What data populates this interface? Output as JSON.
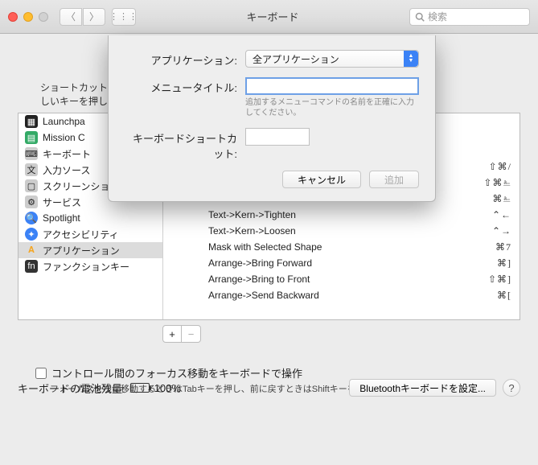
{
  "window": {
    "title": "キーボード",
    "search_placeholder": "検索"
  },
  "instruction": "ショートカットを変更するには、ショートカットを選択し、キーコンビネーションをクリックしてから、新しいキーを押します。",
  "instruction_line1": "ショートカット",
  "instruction_line2": "しいキーを押し",
  "sidebar": {
    "items": [
      {
        "label": "Launchpa",
        "icon": "launchpad-icon"
      },
      {
        "label": "Mission C",
        "icon": "mission-control-icon"
      },
      {
        "label": "キーボート",
        "icon": "keyboard-icon"
      },
      {
        "label": "入力ソース",
        "icon": "input-sources-icon"
      },
      {
        "label": "スクリーンショット",
        "icon": "screenshot-icon"
      },
      {
        "label": "サービス",
        "icon": "services-icon"
      },
      {
        "label": "Spotlight",
        "icon": "spotlight-icon"
      },
      {
        "label": "アクセシビリティ",
        "icon": "accessibility-icon"
      },
      {
        "label": "アプリケーション",
        "icon": "apps-icon",
        "selected": true
      },
      {
        "label": "ファンクションキー",
        "icon": "fn-icon"
      }
    ]
  },
  "shortcuts": [
    {
      "label": "",
      "combo": "⇧⌘/"
    },
    {
      "label": "",
      "combo": "⇧⌘⎁"
    },
    {
      "label": "",
      "combo": "⌘⎁"
    },
    {
      "label": "Text->Kern->Tighten",
      "combo": "⌃←"
    },
    {
      "label": "Text->Kern->Loosen",
      "combo": "⌃→"
    },
    {
      "label": "Mask with Selected Shape",
      "combo": "⌘7"
    },
    {
      "label": "Arrange->Bring Forward",
      "combo": "⌘]"
    },
    {
      "label": "Arrange->Bring to Front",
      "combo": "⇧⌘]"
    },
    {
      "label": "Arrange->Send Backward",
      "combo": "⌘["
    }
  ],
  "sheet": {
    "app_label": "アプリケーション:",
    "app_value": "全アプリケーション",
    "menu_label": "メニュータイトル:",
    "menu_value": "",
    "menu_help": "追加するメニューコマンドの名前を正確に入力してください。",
    "key_label": "キーボードショートカット:",
    "key_value": "",
    "cancel": "キャンセル",
    "add": "追加"
  },
  "focus_checkbox": {
    "label": "コントロール間のフォーカス移動をキーボードで操作",
    "checked": false
  },
  "focus_hint": "フォーカスを次に移動するときはTabキーを押し、前に戻すときはShiftキーを押したままTabキーを押します。",
  "battery": {
    "label": "キーボードの電池残量:",
    "value": "100%"
  },
  "bt_button": "Bluetoothキーボードを設定..."
}
